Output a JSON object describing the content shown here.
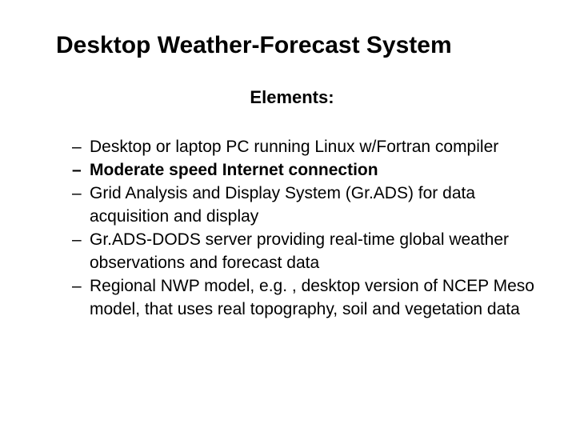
{
  "title": "Desktop Weather-Forecast System",
  "subtitle": "Elements:",
  "bullets": [
    {
      "text": "Desktop or laptop PC running Linux w/Fortran compiler",
      "bold": false
    },
    {
      "text": "Moderate speed Internet connection",
      "bold": true
    },
    {
      "text": "Grid Analysis and Display System (Gr.ADS) for data acquisition and display",
      "bold": false
    },
    {
      "text": "Gr.ADS-DODS server providing real-time global weather observations and forecast data",
      "bold": false
    },
    {
      "text": "Regional NWP model, e.g. , desktop version of NCEP Meso model, that uses real topography, soil and vegetation data",
      "bold": false
    }
  ]
}
